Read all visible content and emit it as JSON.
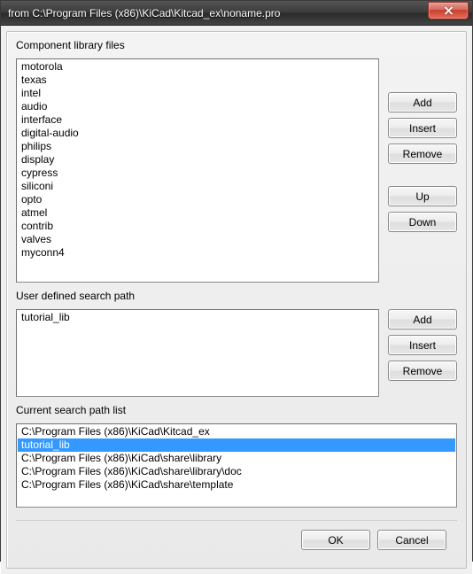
{
  "window": {
    "title": "from C:\\Program Files (x86)\\KiCad\\Kitcad_ex\\noname.pro"
  },
  "labels": {
    "component_files": "Component library files",
    "user_search_path": "User defined search path",
    "current_search_path": "Current search path list"
  },
  "buttons": {
    "add": "Add",
    "insert": "Insert",
    "remove": "Remove",
    "up": "Up",
    "down": "Down",
    "ok": "OK",
    "cancel": "Cancel"
  },
  "component_files": [
    "motorola",
    "texas",
    "intel",
    "audio",
    "interface",
    "digital-audio",
    "philips",
    "display",
    "cypress",
    "siliconi",
    "opto",
    "atmel",
    "contrib",
    "valves",
    "myconn4"
  ],
  "user_search_paths": [
    "tutorial_lib"
  ],
  "current_search_paths": [
    {
      "text": "C:\\Program Files (x86)\\KiCad\\Kitcad_ex",
      "selected": false
    },
    {
      "text": "tutorial_lib",
      "selected": true
    },
    {
      "text": "C:\\Program Files (x86)\\KiCad\\share\\library",
      "selected": false
    },
    {
      "text": "C:\\Program Files (x86)\\KiCad\\share\\library\\doc",
      "selected": false
    },
    {
      "text": "C:\\Program Files (x86)\\KiCad\\share\\template",
      "selected": false
    }
  ]
}
